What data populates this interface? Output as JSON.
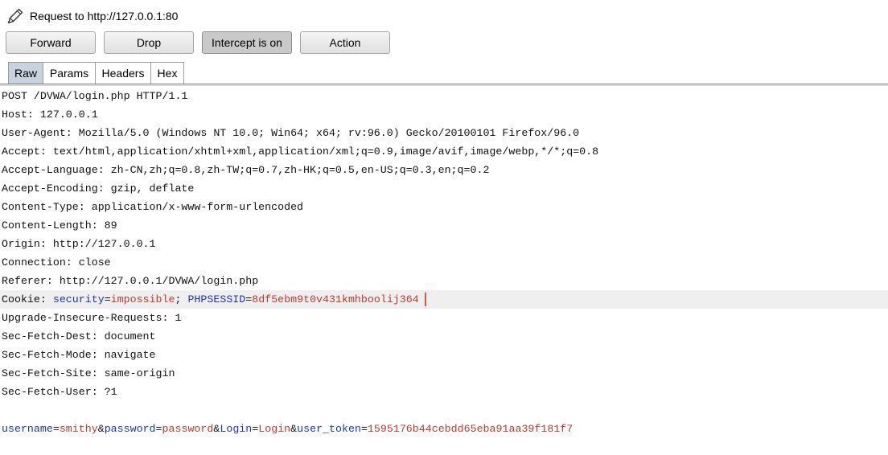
{
  "header": {
    "title": "Request to http://127.0.0.1:80",
    "icon": "pencil-icon"
  },
  "toolbar": {
    "forward": "Forward",
    "drop": "Drop",
    "intercept": "Intercept is on",
    "intercept_pressed": true,
    "action": "Action"
  },
  "tabs": [
    {
      "label": "Raw",
      "selected": true
    },
    {
      "label": "Params",
      "selected": false
    },
    {
      "label": "Headers",
      "selected": false
    },
    {
      "label": "Hex",
      "selected": false
    }
  ],
  "request": {
    "lines": [
      "POST /DVWA/login.php HTTP/1.1",
      "Host: 127.0.0.1",
      "User-Agent: Mozilla/5.0 (Windows NT 10.0; Win64; x64; rv:96.0) Gecko/20100101 Firefox/96.0",
      "Accept: text/html,application/xhtml+xml,application/xml;q=0.9,image/avif,image/webp,*/*;q=0.8",
      "Accept-Language: zh-CN,zh;q=0.8,zh-TW;q=0.7,zh-HK;q=0.5,en-US;q=0.3,en;q=0.2",
      "Accept-Encoding: gzip, deflate",
      "Content-Type: application/x-www-form-urlencoded",
      "Content-Length: 89",
      "Origin: http://127.0.0.1",
      "Connection: close",
      "Referer: http://127.0.0.1/DVWA/login.php"
    ],
    "cookie": {
      "label": "Cookie: ",
      "params": [
        {
          "name": "security",
          "value": "impossible"
        },
        {
          "name": "PHPSESSID",
          "value": "8df5ebm9t0v431kmhboolij364"
        }
      ]
    },
    "lines_after_cookie": [
      "Upgrade-Insecure-Requests: 1",
      "Sec-Fetch-Dest: document",
      "Sec-Fetch-Mode: navigate",
      "Sec-Fetch-Site: same-origin",
      "Sec-Fetch-User: ?1"
    ],
    "body": {
      "params": [
        {
          "name": "username",
          "value": "smithy"
        },
        {
          "name": "password",
          "value": "password"
        },
        {
          "name": "Login",
          "value": "Login"
        },
        {
          "name": "user_token",
          "value": "1595176b44cebdd65eba91aa39f181f7"
        }
      ]
    }
  },
  "syntax": {
    "assign": "=",
    "cookie_separator": "; ",
    "body_separator": "&"
  },
  "colors": {
    "param_name": "#1d35b8",
    "param_value": "#c0392b",
    "highlight_row": "#efefef",
    "caret": "#e8552f",
    "selected_tab": "#c8d3df",
    "pressed_button": "#c9c9c9"
  }
}
